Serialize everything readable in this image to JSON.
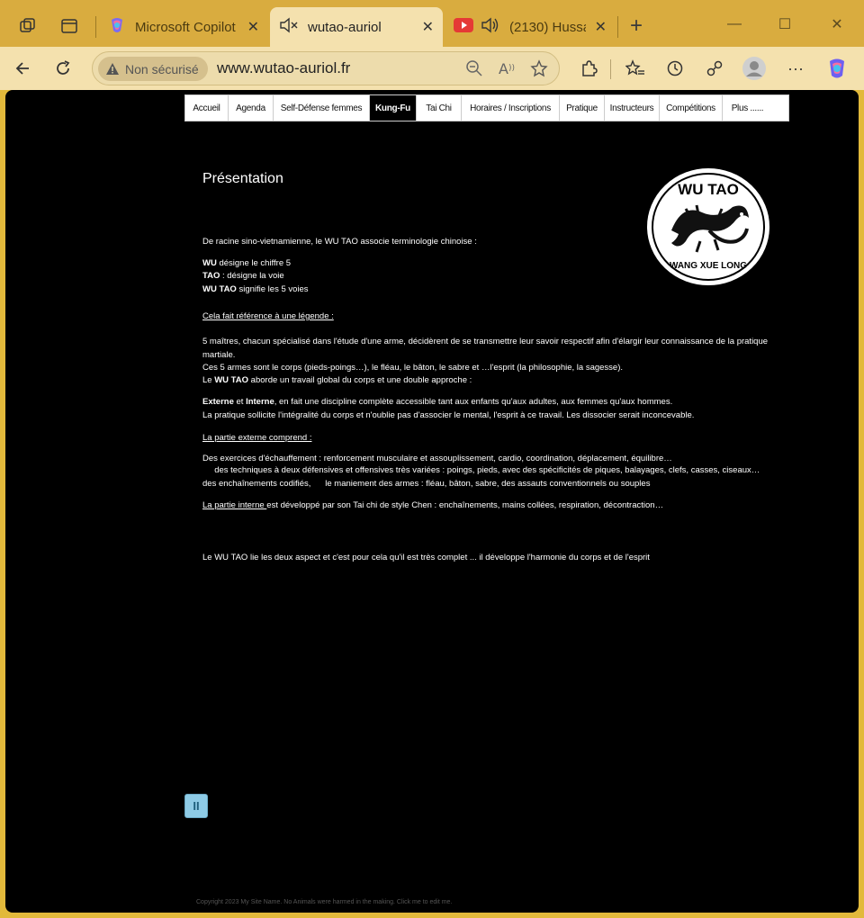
{
  "browser": {
    "tabs": [
      {
        "label": "Microsoft Copilot",
        "icon": "copilot-icon",
        "active": false
      },
      {
        "label": "wutao-auriol",
        "icon": "muted-speaker-icon",
        "active": true
      },
      {
        "label": "(2130) Hussa",
        "icon": "youtube-icon",
        "active": false
      }
    ],
    "new_tab_label": "+",
    "security_label": "Non sécurisé",
    "url": "www.wutao-auriol.fr"
  },
  "site": {
    "nav": [
      "Accueil",
      "Agenda",
      "Self-Défense femmes",
      "Kung-Fu",
      "Tai Chi",
      "Horaires / Inscriptions",
      "Pratique",
      "Instructeurs",
      "Compétitions",
      "Plus ......"
    ],
    "active_nav": "Kung-Fu",
    "title": "Présentation",
    "logo_text_top": "WU TAO",
    "logo_text_bottom": "WANG XUE LONG",
    "intro": "De racine sino-vietnamienne, le WU TAO associe terminologie chinoise :",
    "wu_term": "WU",
    "wu_def": " désigne  le chiffre 5",
    "tao_term": "TAO",
    "tao_def": " : désigne  la voie",
    "wutao_term": "WU TAO",
    "wutao_def": " signifie les 5 voies",
    "legend_heading": "Cela  fait référence à une légende :",
    "legend_p1": "5 maîtres, chacun spécialisé dans l'étude d'une arme, décidèrent de se transmettre leur savoir respectif afin d'élargir leur connaissance de la pratique martiale.",
    "legend_p2": "Ces 5 armes sont le corps (pieds-poings…), le fléau, le bâton, le sabre et …l'esprit (la philosophie, la sagesse).",
    "legend_p3_a": "Le ",
    "legend_p3_b": "WU TAO",
    "legend_p3_c": " aborde un travail global du corps et une double approche :",
    "approach_a": "Externe",
    "approach_b": " et ",
    "approach_c": "Interne",
    "approach_d": ", en fait une discipline complète accessible tant aux enfants qu'aux adultes, aux femmes qu'aux hommes.",
    "approach_p2": "La pratique sollicite l'intégralité du corps et n'oublie pas d'associer le mental, l'esprit à ce travail. Les dissocier serait inconcevable.",
    "external_heading": "La partie externe comprend :",
    "external_l1": " Des exercices d'échauffement : renforcement musculaire et assouplissement, cardio, coordination, déplacement, équilibre…",
    "external_l2": "     des techniques à deux défensives et offensives très variées : poings, pieds, avec des spécificités de piques, balayages, clefs, casses, ciseaux…     des enchaînements codifiés,      le maniement des armes : fléau, bâton, sabre, des assauts conventionnels ou souples",
    "internal_heading": "La partie interne ",
    "internal_text": " est développé par son Tai chi de style Chen : enchaînements, mains collées, respiration, décontraction…",
    "conclusion": "Le WU TAO lie les deux aspect et c'est pour cela qu'il est très complet ... il développe l'harmonie du corps et de l'esprit",
    "pause_label": "II",
    "footer": "Copyright 2023 My Site Name. No Animals were harmed in the making. Click me to edit me."
  }
}
